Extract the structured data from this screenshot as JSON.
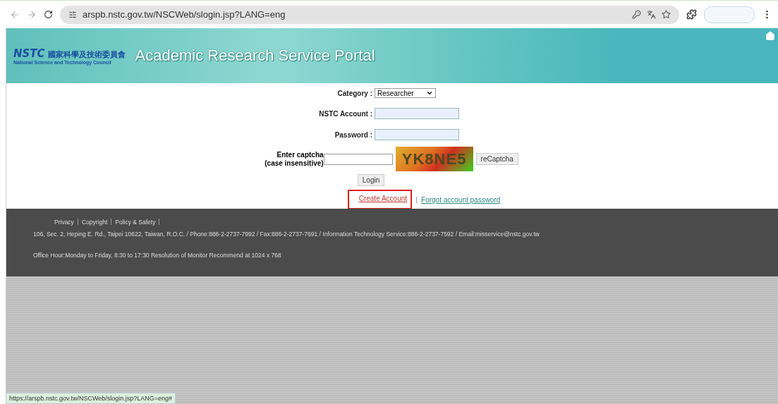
{
  "browser": {
    "url": "arspb.nstc.gov.tw/NSCWeb/slogin.jsp?LANG=eng"
  },
  "banner": {
    "logo_abbr": "NSTC",
    "logo_chinese": "國家科學及技術委員會",
    "logo_english": "National Science and Technology Council",
    "title": "Academic Research Service Portal"
  },
  "form": {
    "category_label": "Category :",
    "category_value": "Researcher",
    "account_label": "NSTC Account :",
    "password_label": "Password :",
    "captcha_label": "Enter captcha",
    "captcha_hint": "(case insensitive)",
    "captcha_code": "YK8NE5",
    "recaptcha_button": "reCaptcha",
    "login_button": "Login",
    "links": [
      {
        "label": "Create Account",
        "highlighted": true
      },
      {
        "label": "Forgot account password",
        "highlighted": false
      }
    ]
  },
  "footer": {
    "links": [
      "Privacy",
      "Copyright",
      "Policy & Safety"
    ],
    "address": "106, Sec. 2, Heping E. Rd., Taipei 10622, Taiwan, R.O.C. / Phone:886-2-2737-7992 / Fax:886-2-2737-7691 / Information Technology Service:886-2-2737-7592 / Email:misservice@nstc.gov.tw",
    "hours": "Office Hour:Monday to Friday, 8:30 to 17:30 Resolution of Monitor Recommend at 1024 x 768"
  },
  "status_bar": {
    "url": "https://arspb.nstc.gov.tw/NSCWeb/slogin.jsp?LANG=eng#"
  }
}
